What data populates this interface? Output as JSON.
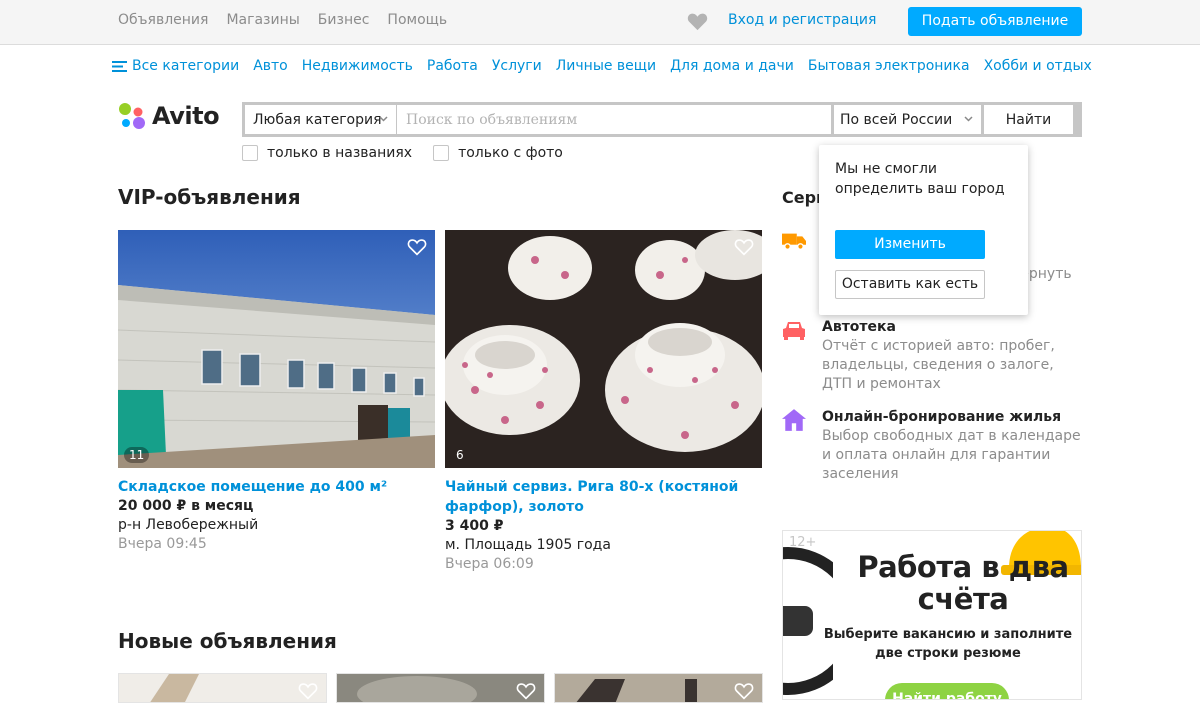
{
  "topbar": {
    "nav": [
      "Объявления",
      "Магазины",
      "Бизнес",
      "Помощь"
    ],
    "favorites_icon": "heart-icon",
    "login": "Вход и регистрация",
    "post_button": "Подать объявление"
  },
  "categories": {
    "all": "Все категории",
    "items": [
      "Авто",
      "Недвижимость",
      "Работа",
      "Услуги",
      "Личные вещи",
      "Для дома и дачи",
      "Бытовая электроника",
      "Хобби и отдых"
    ]
  },
  "logo": {
    "text": "Avito",
    "colors": [
      "#97cf26",
      "#ff6163",
      "#0af",
      "#a169f7"
    ]
  },
  "search": {
    "category": "Любая категория",
    "placeholder": "Поиск по объявлениям",
    "region": "По всей России",
    "button": "Найти",
    "only_titles": "только в названиях",
    "only_photo": "только с фото"
  },
  "vip": {
    "title": "VIP-объявления",
    "items": [
      {
        "photos": "11",
        "title": "Складское помещение до 400 м²",
        "price": "20 000 ₽ в месяц",
        "location": "р-н Левобережный",
        "time": "Вчера 09:45"
      },
      {
        "photos": "6",
        "title": "Чайный сервиз. Рига 80-х (костяной фарфор), золото",
        "price": "3 400 ₽",
        "location": "м. Площадь 1905 года",
        "time": "Вчера 06:09"
      }
    ]
  },
  "new_ads": {
    "title": "Новые объявления"
  },
  "services": {
    "title": "Сервисы и услуги Авито",
    "items": [
      {
        "icon": "truck-icon",
        "name": "",
        "desc": "и\nвернуть",
        "color": "#ff9900"
      },
      {
        "icon": "car-icon",
        "name": "Автотека",
        "desc": "Отчёт с историей авто: пробег, владельцы, сведения о залоге, ДТП и ремонтах",
        "color": "#ff6163"
      },
      {
        "icon": "house-icon",
        "name": "Онлайн-бронирование жилья",
        "desc": "Выбор свободных дат в календаре и оплата онлайн для гарантии заселения",
        "color": "#a169f7"
      }
    ]
  },
  "city_popup": {
    "text": "Мы не смогли определить ваш город",
    "change": "Изменить",
    "keep": "Оставить как есть"
  },
  "ad": {
    "age": "12+",
    "headline": "Работа в два счёта",
    "subtext": "Выберите вакансию и заполните две строки резюме",
    "cta": "Найти работу"
  },
  "colors": {
    "accent": "#00aaff",
    "link": "#0091d9"
  }
}
